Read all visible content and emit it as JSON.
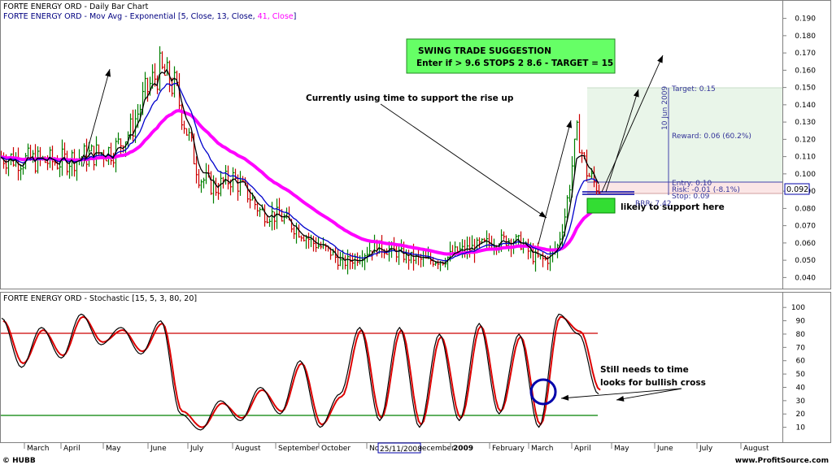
{
  "header": {
    "line1": "FORTE ENERGY ORD - Daily Bar Chart",
    "line2_prefix": "FORTE ENERGY ORD - Mov Avg - Exponential [5, Close, 13, Close, ",
    "line2_p41": "41, Close",
    "line2_suffix": "]"
  },
  "trade_box": {
    "title": "SWING TRADE SUGGESTION",
    "detail": "Enter if > 9.6  STOPS 2 8.6 - TARGET = 15"
  },
  "annotations": {
    "time_note": "Currently using time to support the rise up",
    "support_note": "likely to support here",
    "stoch_note1": "Still needs to time",
    "stoch_note2": "looks for bullish cross"
  },
  "trade_levels": {
    "target": "Target: 0.15",
    "reward": "Reward: 0.06 (60.2%)",
    "entry": "Entry: 0.10",
    "risk": "Risk: -0.01 (-8.1%)",
    "stop": "Stop: 0.09",
    "rrr": "RRR: 7.42",
    "date": "10 Jun 2009"
  },
  "last_price": "0.092",
  "stoch_label": "FORTE ENERGY ORD - Stochastic [15, 5, 3, 80, 20]",
  "date_marker": "25/11/2008",
  "footer": {
    "left": "© HUBB",
    "right": "www.ProfitSource.com"
  },
  "colors": {
    "up": "#008000",
    "down": "#cc0000",
    "ema5": "#000000",
    "ema13": "#0000cc",
    "ema41": "#ff00ff",
    "note_bg": "#66ff66"
  },
  "chart_data": [
    {
      "type": "line",
      "title": "FORTE ENERGY ORD - Daily Bar Chart",
      "ylim": [
        0.035,
        0.195
      ],
      "y_ticks": [
        0.04,
        0.05,
        0.06,
        0.07,
        0.08,
        0.09,
        0.1,
        0.11,
        0.12,
        0.13,
        0.14,
        0.15,
        0.16,
        0.17,
        0.18,
        0.19
      ],
      "y_tick_labels": [
        "0.040",
        "0.050",
        "0.060",
        "0.070",
        "0.080",
        "0.090",
        "0.100",
        "0.110",
        "0.120",
        "0.130",
        "0.140",
        "0.150",
        "0.160",
        "0.170",
        "0.180",
        "0.190"
      ],
      "x_tick_labels": [
        "March",
        "April",
        "May",
        "June",
        "July",
        "August",
        "September",
        "October",
        "November",
        "December",
        "2009",
        "February",
        "March",
        "April",
        "May",
        "June",
        "July",
        "August"
      ],
      "x": [
        "Mar-08",
        "Apr-08",
        "May-08",
        "Jun-08",
        "Jul-08",
        "Aug-08",
        "Sep-08",
        "Oct-08",
        "Nov-08",
        "Dec-08",
        "Jan-09",
        "Feb-09",
        "Mar-09",
        "Apr-09"
      ],
      "series": [
        {
          "name": "Close",
          "values": [
            0.11,
            0.108,
            0.112,
            0.15,
            0.1,
            0.078,
            0.07,
            0.05,
            0.055,
            0.05,
            0.058,
            0.06,
            0.055,
            0.095
          ]
        },
        {
          "name": "Mov Avg - Exponential 5",
          "values": [
            0.11,
            0.107,
            0.113,
            0.145,
            0.102,
            0.08,
            0.072,
            0.052,
            0.055,
            0.051,
            0.057,
            0.06,
            0.056,
            0.1
          ]
        },
        {
          "name": "Mov Avg - Exponential 13",
          "values": [
            0.11,
            0.108,
            0.112,
            0.135,
            0.108,
            0.085,
            0.075,
            0.055,
            0.054,
            0.052,
            0.056,
            0.059,
            0.057,
            0.093
          ]
        },
        {
          "name": "Mov Avg - Exponential 41",
          "values": [
            0.108,
            0.109,
            0.111,
            0.128,
            0.118,
            0.098,
            0.085,
            0.07,
            0.06,
            0.054,
            0.054,
            0.057,
            0.057,
            0.08
          ]
        }
      ]
    },
    {
      "type": "line",
      "title": "FORTE ENERGY ORD - Stochastic [15, 5, 3, 80, 20]",
      "ylim": [
        0,
        105
      ],
      "y_ticks": [
        10,
        20,
        30,
        40,
        50,
        60,
        70,
        80,
        90,
        100
      ],
      "y_tick_labels": [
        "10",
        "20",
        "30",
        "40",
        "50",
        "60",
        "70",
        "80",
        "90",
        "100"
      ],
      "reference_lines": [
        80,
        20
      ],
      "series": [
        {
          "name": "%K",
          "values": [
            92,
            55,
            85,
            62,
            95,
            72,
            85,
            65,
            90,
            20,
            8,
            30,
            15,
            40,
            20,
            60,
            10,
            35,
            85,
            15,
            85,
            10,
            80,
            15,
            88,
            20,
            80,
            10,
            95,
            80,
            35
          ]
        },
        {
          "name": "%D",
          "values": [
            90,
            58,
            83,
            64,
            93,
            74,
            83,
            67,
            88,
            22,
            10,
            28,
            17,
            38,
            22,
            58,
            12,
            33,
            83,
            17,
            83,
            12,
            78,
            17,
            86,
            22,
            78,
            12,
            93,
            82,
            38
          ]
        }
      ]
    }
  ]
}
